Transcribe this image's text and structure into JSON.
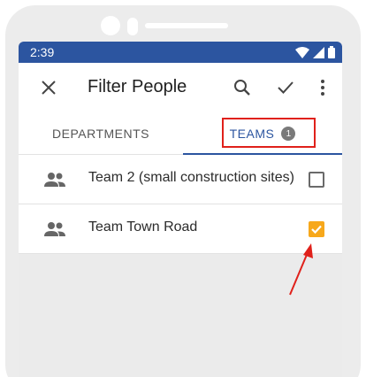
{
  "status_bar": {
    "time": "2:39"
  },
  "app_bar": {
    "title": "Filter People"
  },
  "tabs": [
    {
      "label": "DEPARTMENTS",
      "selected": false
    },
    {
      "label": "TEAMS",
      "selected": true,
      "badge": "1"
    }
  ],
  "teams": [
    {
      "name": "Team 2 (small construction sites)",
      "checked": false
    },
    {
      "name": "Team Town Road",
      "checked": true
    }
  ],
  "colors": {
    "primary": "#2c55a0",
    "checkbox_checked": "#f7a81b",
    "annotation": "#e0211b"
  },
  "icons": [
    "close-icon",
    "search-icon",
    "check-icon",
    "more-vert-icon",
    "people-icon",
    "wifi-icon",
    "signal-icon",
    "battery-icon"
  ]
}
